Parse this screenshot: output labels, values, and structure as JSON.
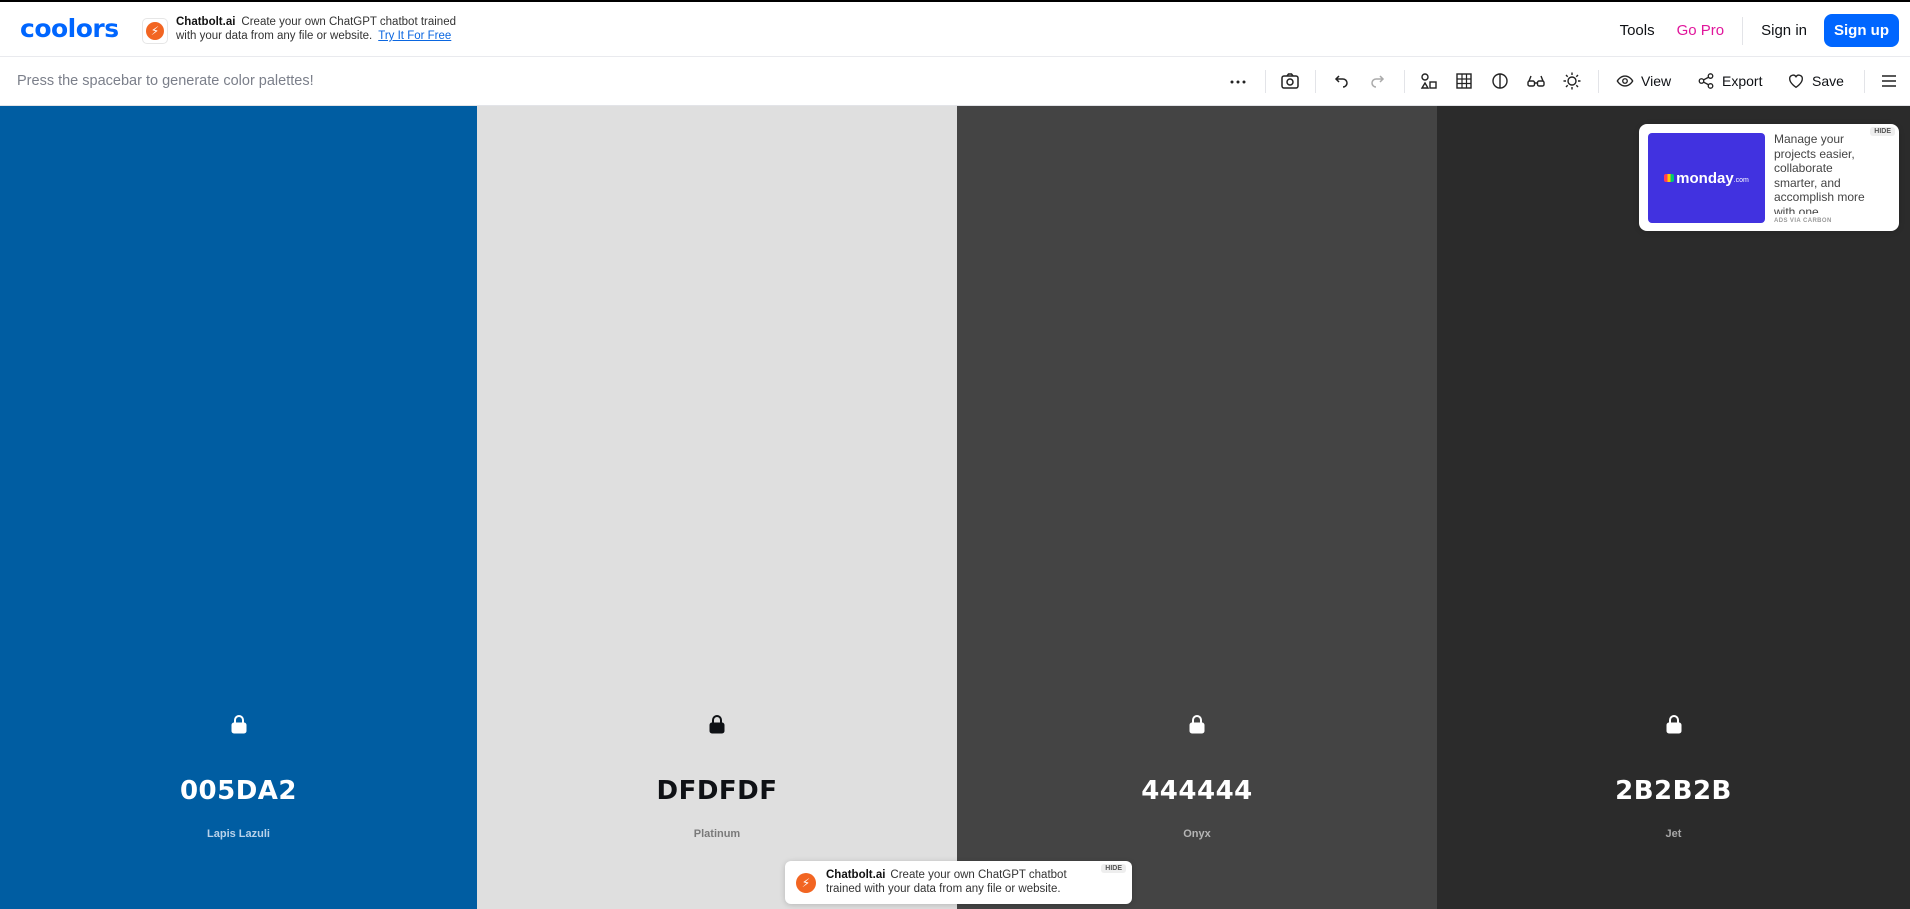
{
  "brand": {
    "logo": "coolors"
  },
  "promo": {
    "icon": "chatbolt-icon",
    "name": "Chatbolt.ai",
    "text": "Create your own ChatGPT chatbot trained with your data from any file or website.",
    "cta": "Try It For Free"
  },
  "nav": {
    "tools": "Tools",
    "go_pro": "Go Pro",
    "sign_in": "Sign in",
    "sign_up": "Sign up"
  },
  "toolbar": {
    "hint": "Press the spacebar to generate color palettes!",
    "more": "···",
    "view": "View",
    "export": "Export",
    "save": "Save"
  },
  "palette": [
    {
      "hex": "005DA2",
      "name": "Lapis Lazuli",
      "bg": "#005DA2",
      "fg": "#ffffff",
      "name_color": "#b9d2ea"
    },
    {
      "hex": "DFDFDF",
      "name": "Platinum",
      "bg": "#DFDFDF",
      "fg": "#0f1115",
      "name_color": "#7a7a7a"
    },
    {
      "hex": "444444",
      "name": "Onyx",
      "bg": "#444444",
      "fg": "#ffffff",
      "name_color": "#b5b5b5"
    },
    {
      "hex": "2B2B2B",
      "name": "Jet",
      "bg": "#2B2B2B",
      "fg": "#ffffff",
      "name_color": "#a8a8a8"
    }
  ],
  "carbon_ad": {
    "brand": "monday",
    "brand_suffix": ".com",
    "text": "Manage your projects easier, collaborate smarter, and accomplish more with one",
    "via": "ADS VIA CARBON",
    "hide": "HIDE"
  },
  "bottom_ad": {
    "name": "Chatbolt.ai",
    "text": "Create your own ChatGPT chatbot trained with your data from any file or website.",
    "hide": "HIDE"
  },
  "colors": {
    "accent": "#0066ff",
    "pro": "#e0169b"
  }
}
